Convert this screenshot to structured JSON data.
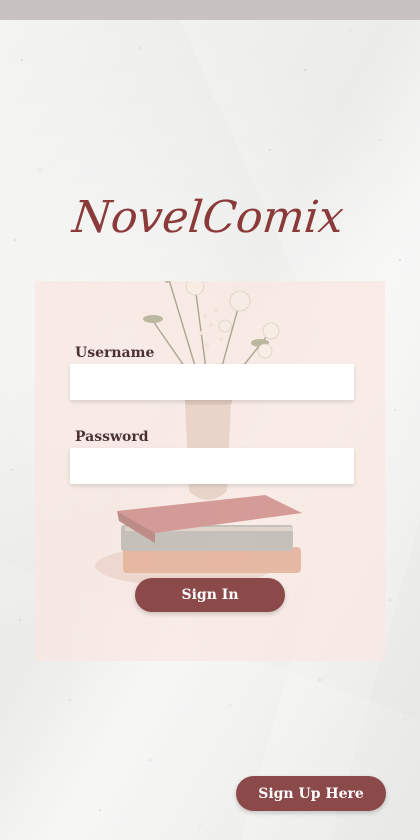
{
  "app": {
    "brand_name": "NovelComix",
    "brand_color": "#8b3a3a"
  },
  "login_form": {
    "username_label": "Username",
    "username_value": "",
    "password_label": "Password",
    "password_value": "",
    "sign_in_label": "Sign In"
  },
  "footer": {
    "sign_up_label": "Sign Up Here"
  },
  "colors": {
    "button": "#8b4a49",
    "panel": "#fae8e0",
    "top_bar": "#c9c2c2"
  }
}
